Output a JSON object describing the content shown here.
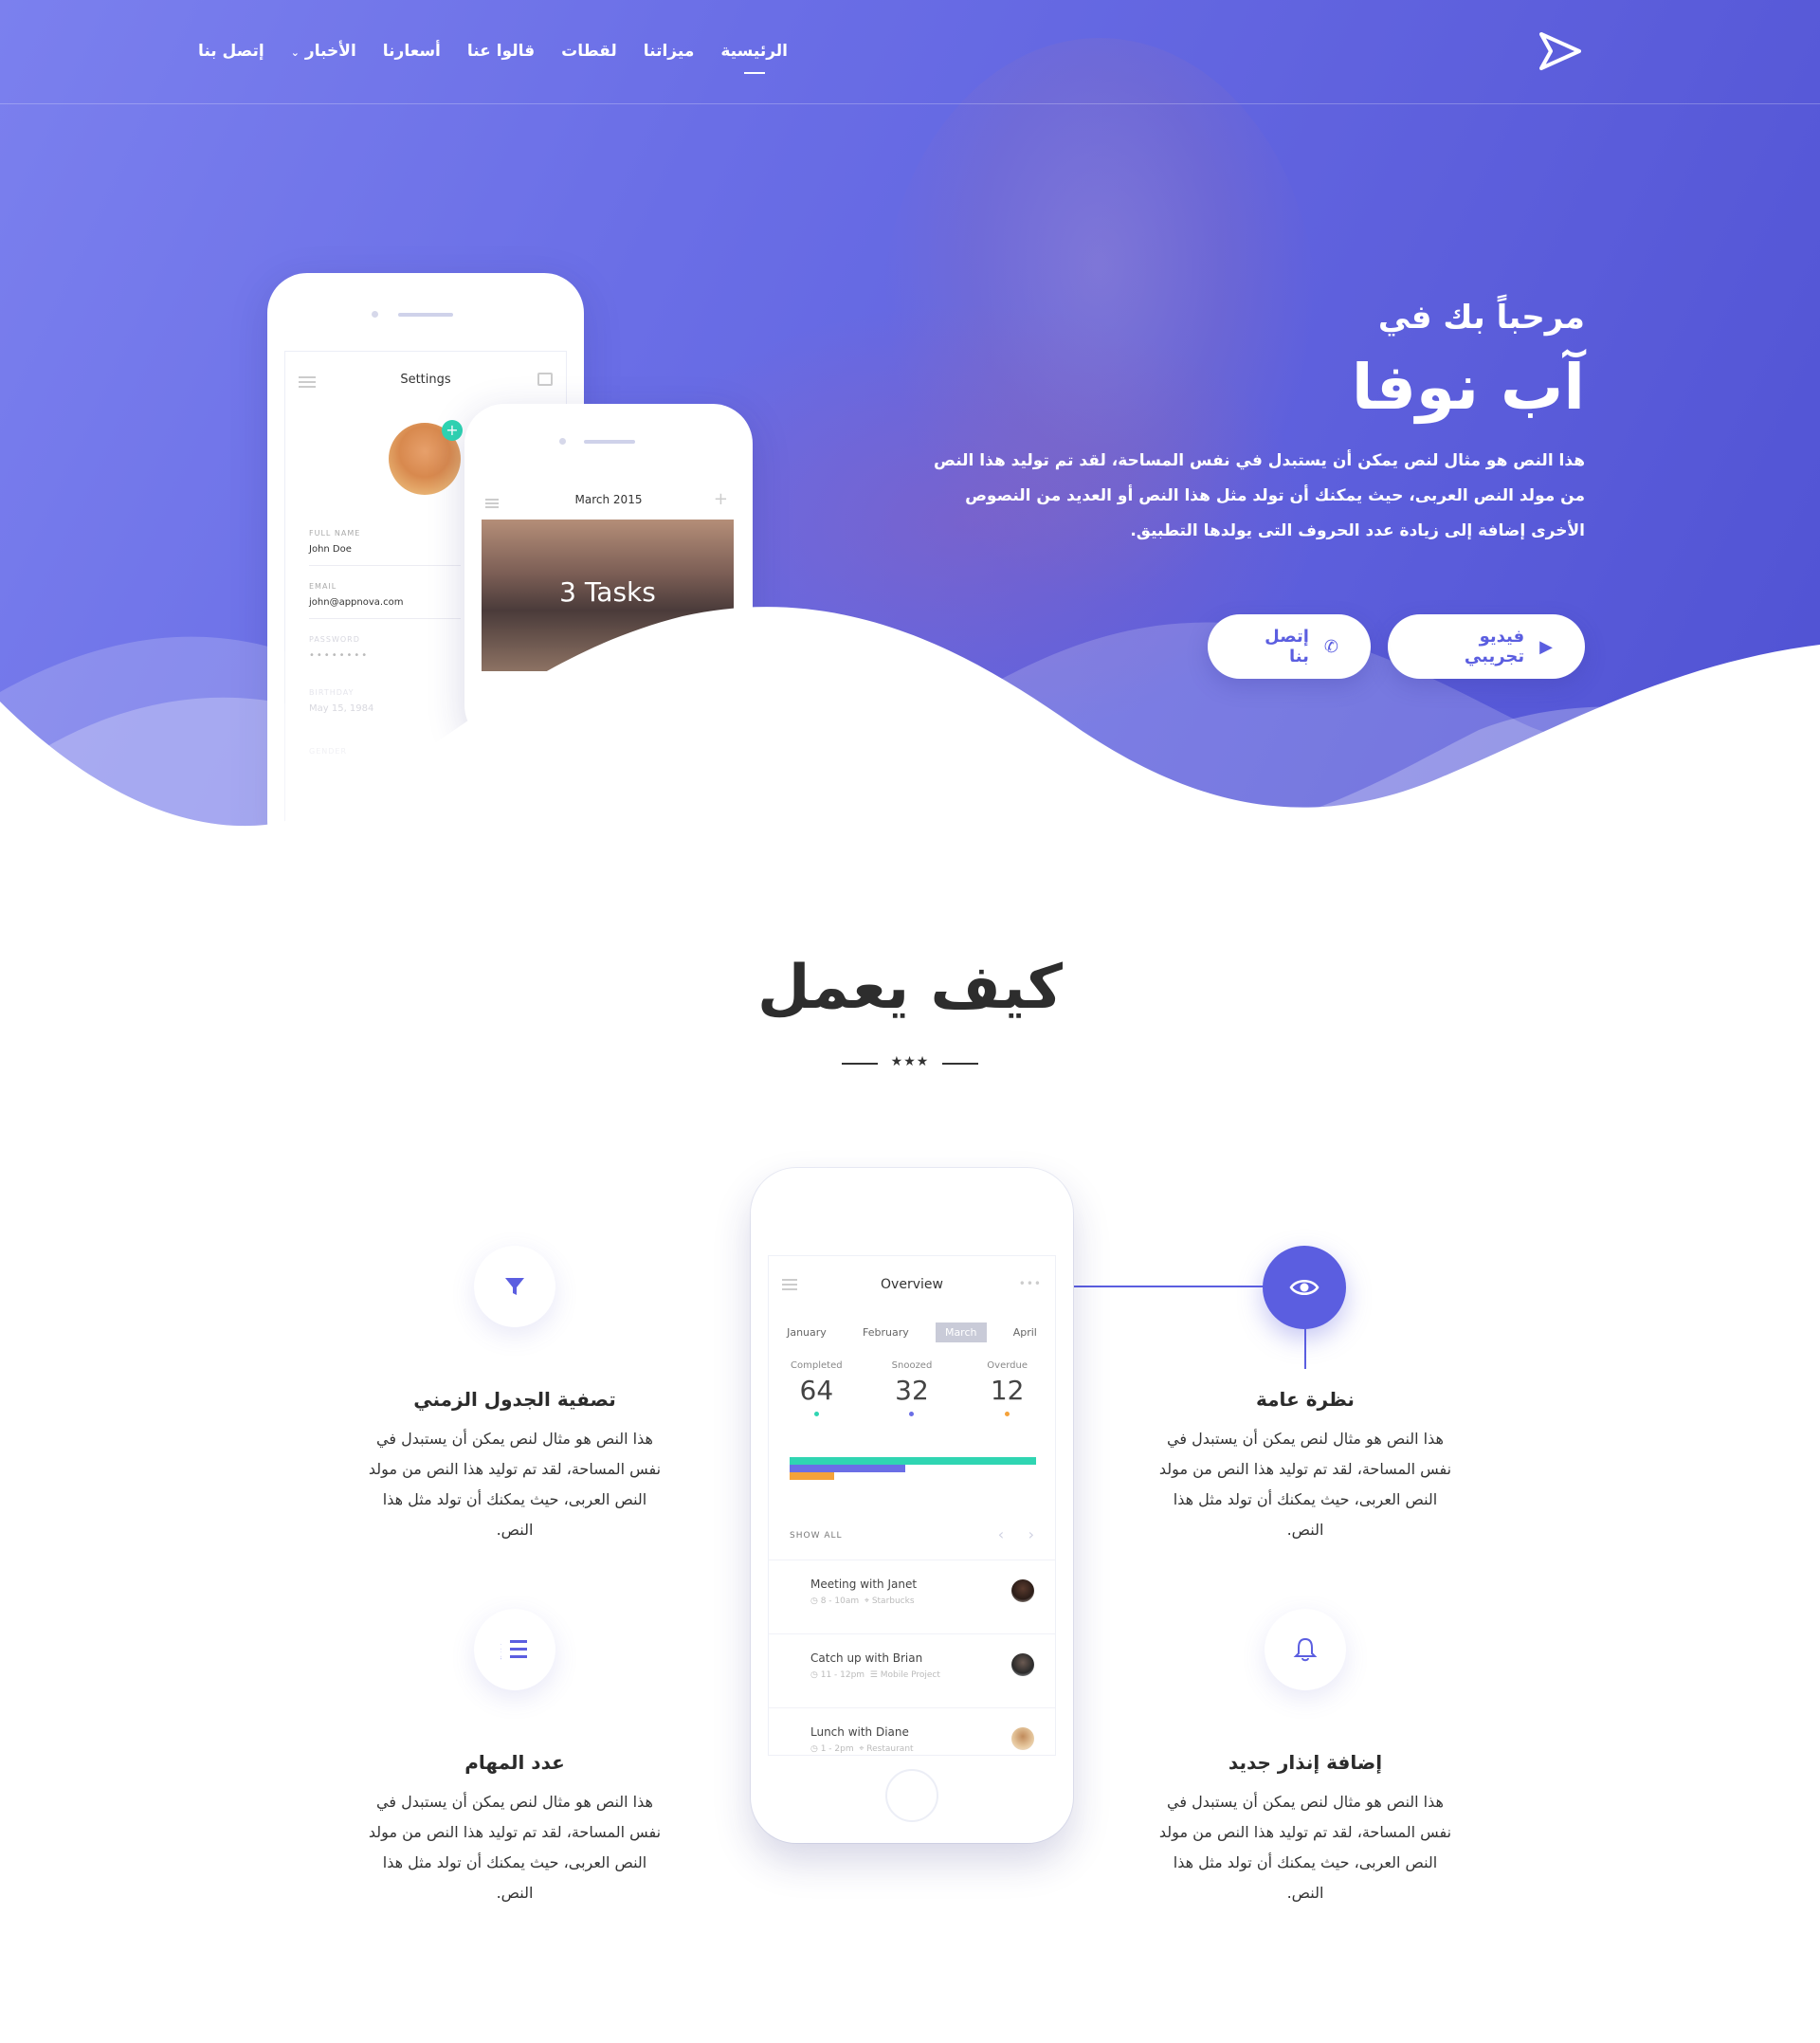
{
  "nav": {
    "items": [
      {
        "label": "الرئيسية",
        "active": true
      },
      {
        "label": "ميزاتنا"
      },
      {
        "label": "لقطات"
      },
      {
        "label": "قالوا عنا"
      },
      {
        "label": "أسعارنا"
      },
      {
        "label": "الأخبار",
        "has_dropdown": true
      },
      {
        "label": "إتصل بنا"
      }
    ],
    "logo_icon": "play-triangle-logo-icon"
  },
  "hero": {
    "pre_title": "مرحباً بك في",
    "title": "آب نوفا",
    "description": "هذا النص هو مثال لنص يمكن أن يستبدل في نفس المساحة، لقد تم توليد هذا النص من مولد النص العربى، حيث يمكنك أن تولد مثل هذا النص أو العديد من النصوص الأخرى إضافة إلى زيادة عدد الحروف التى يولدها التطبيق.",
    "btn_video": "فيديو تجريبي",
    "btn_contact": "إتصل بنا",
    "accent_color": "#5b5ee0"
  },
  "phones_hero": {
    "settings": {
      "title": "Settings",
      "full_name_label": "FULL NAME",
      "full_name": "John Doe",
      "email_label": "EMAIL",
      "email": "john@appnova.com",
      "password_label": "PASSWORD",
      "password": "••••••••",
      "birthday_label": "BIRTHDAY",
      "birthday": "May 15, 1984",
      "gender_label": "GENDER"
    },
    "calendar": {
      "title": "March 2015",
      "tasks": "3 Tasks"
    }
  },
  "how": {
    "title": "كيف يعمل",
    "stars": "★★★"
  },
  "features": [
    {
      "title": "نظرة عامة",
      "desc": "هذا النص هو مثال لنص يمكن أن يستبدل في نفس المساحة، لقد تم توليد هذا النص من مولد النص العربى، حيث يمكنك أن تولد مثل هذا النص.",
      "icon": "eye-icon",
      "active": true
    },
    {
      "title": "تصفية الجدول الزمني",
      "desc": "هذا النص هو مثال لنص يمكن أن يستبدل في نفس المساحة، لقد تم توليد هذا النص من مولد النص العربى، حيث يمكنك أن تولد مثل هذا النص.",
      "icon": "filter-icon"
    },
    {
      "title": "إضافة إنذار جديد",
      "desc": "هذا النص هو مثال لنص يمكن أن يستبدل في نفس المساحة، لقد تم توليد هذا النص من مولد النص العربى، حيث يمكنك أن تولد مثل هذا النص.",
      "icon": "bell-icon"
    },
    {
      "title": "عدد المهام",
      "desc": "هذا النص هو مثال لنص يمكن أن يستبدل في نفس المساحة، لقد تم توليد هذا النص من مولد النص العربى، حيث يمكنك أن تولد مثل هذا النص.",
      "icon": "numbered-list-icon"
    }
  ],
  "overview_phone": {
    "title": "Overview",
    "months": [
      "January",
      "February",
      "March",
      "April"
    ],
    "selected_month": "March",
    "stats": [
      {
        "label": "Completed",
        "value": "64",
        "color": "#2fd5b2"
      },
      {
        "label": "Snoozed",
        "value": "32",
        "color": "#6a6ee6"
      },
      {
        "label": "Overdue",
        "value": "12",
        "color": "#f5a23a"
      }
    ],
    "bar_fractions": {
      "completed": 1.0,
      "snoozed": 0.47,
      "overdue": 0.18
    },
    "show_all": "SHOW ALL",
    "events": [
      {
        "title": "Meeting with Janet",
        "time": "8 - 10am",
        "place": "Starbucks"
      },
      {
        "title": "Catch up with Brian",
        "time": "11 - 12pm",
        "place": "Mobile Project"
      },
      {
        "title": "Lunch with Diane",
        "time": "1 - 2pm",
        "place": "Restaurant"
      }
    ]
  }
}
